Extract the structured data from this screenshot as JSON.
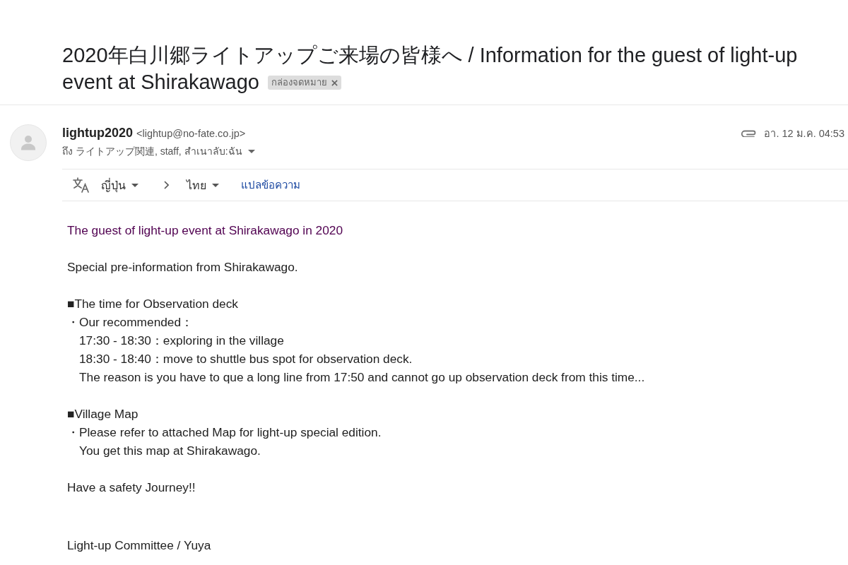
{
  "subject": {
    "title_lines": [
      "2020年白川郷ライトアップご来場の皆様へ / Information for the guest of light-up",
      "event at Shirakawago"
    ],
    "labels": [
      {
        "text": "กล่องจดหมาย",
        "removable": true
      }
    ]
  },
  "message": {
    "sender_name": "lightup2020",
    "sender_email": "<lightup@no-fate.co.jp>",
    "recipients": "ถึง ライトアップ関連, staff, สำเนาลับ:ฉัน",
    "has_attachment": true,
    "date": "อา. 12 ม.ค. 04:53"
  },
  "translate_bar": {
    "source_language": "ญี่ปุ่น",
    "target_language": "ไทย",
    "action": "แปลข้อความ"
  },
  "body": [
    {
      "kind": "title",
      "lines": [
        {
          "kind": "plain",
          "text": "The guest of light-up event at Shirakawago in 2020"
        }
      ]
    },
    {
      "kind": "text",
      "lines": [
        {
          "kind": "plain",
          "text": "Special pre-information from Shirakawago."
        }
      ]
    },
    {
      "kind": "text",
      "lines": [
        {
          "kind": "plain",
          "text": "■The time for Observation deck"
        },
        {
          "kind": "plain",
          "text": "・Our recommended："
        },
        {
          "kind": "indent",
          "text": "17:30 - 18:30：exploring in the village"
        },
        {
          "kind": "indent",
          "text": "18:30 - 18:40：move to shuttle bus spot for observation deck."
        },
        {
          "kind": "indent",
          "text": "The reason is you have to que a long line from 17:50 and cannot go up observation deck from this time..."
        }
      ]
    },
    {
      "kind": "text",
      "lines": [
        {
          "kind": "plain",
          "text": "■Village Map"
        },
        {
          "kind": "plain",
          "text": "・Please refer to attached Map for light-up special edition."
        },
        {
          "kind": "indent",
          "text": "You get this map at Shirakawago."
        }
      ]
    },
    {
      "kind": "text",
      "lines": [
        {
          "kind": "plain",
          "text": "Have a safety Journey!!"
        }
      ]
    },
    {
      "kind": "signature",
      "lines": [
        {
          "kind": "plain",
          "text": "Light-up Committee / Yuya"
        }
      ]
    }
  ]
}
